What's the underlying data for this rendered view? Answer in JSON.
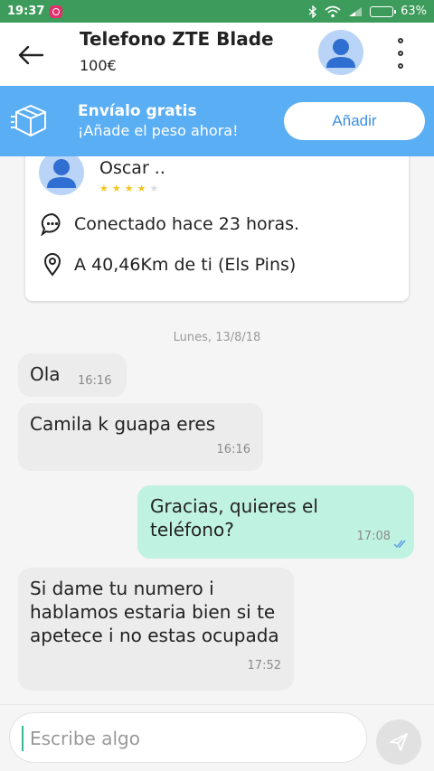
{
  "status_bar": {
    "time": "19:37",
    "battery": "63%",
    "battery_level": 0.63,
    "icons": [
      "instagram-icon",
      "bluetooth-icon",
      "wifi-icon",
      "signal-icon",
      "battery-icon"
    ]
  },
  "header": {
    "title": "Telefono ZTE Blade",
    "price": "100€"
  },
  "banner": {
    "title": "Envíalo gratis",
    "subtitle": "¡Añade el peso ahora!",
    "button": "Añadir",
    "color": "#5aaef4"
  },
  "profile": {
    "name": "Oscar ..",
    "rating": 4.5,
    "rating_max": 5,
    "last_seen": "Conectado hace 23 horas.",
    "location": "A 40,46Km de ti (Els Pins)"
  },
  "chat": {
    "date": "Lunes, 13/8/18",
    "messages": [
      {
        "direction": "in",
        "text": "Ola",
        "time": "16:16"
      },
      {
        "direction": "in",
        "text": "Camila k guapa eres",
        "time": "16:16"
      },
      {
        "direction": "out",
        "text": "Gracias, quieres el teléfono?",
        "time": "17:08",
        "status": "read"
      },
      {
        "direction": "in",
        "text": "Si dame tu numero i hablamos estaria bien si te apetece i no estas ocupada",
        "time": "17:52"
      }
    ],
    "incoming_color": "#ececec",
    "outgoing_color": "#c0f2e1"
  },
  "composer": {
    "placeholder": "Escribe algo",
    "value": ""
  },
  "colors": {
    "status_bar": "#3d9c5b",
    "accent": "#33b89b"
  }
}
